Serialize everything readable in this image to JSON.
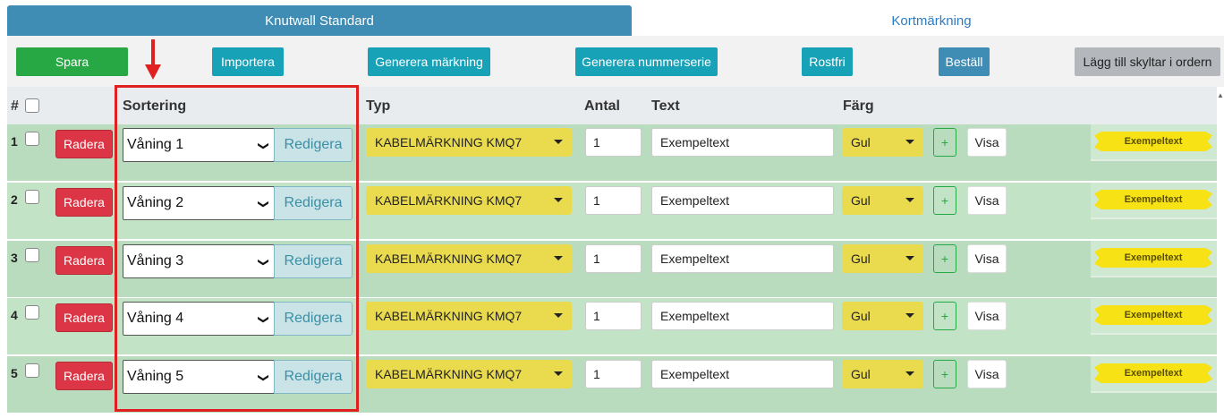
{
  "tabs": [
    {
      "label": "Knutwall Standard",
      "active": true
    },
    {
      "label": "Kortmärkning",
      "active": false
    }
  ],
  "toolbar": {
    "spara": "Spara",
    "importera": "Importera",
    "generera_markning": "Generera märkning",
    "generera_nummerserie": "Generera nummerserie",
    "rostfri": "Rostfri",
    "bestall": "Beställ",
    "lagg_till": "Lägg till skyltar i ordern"
  },
  "header": {
    "num": "#",
    "sortering": "Sortering",
    "typ": "Typ",
    "antal": "Antal",
    "text": "Text",
    "farg": "Färg"
  },
  "rows": [
    {
      "num": "1",
      "radera": "Radera",
      "sortering": "Våning 1",
      "redigera": "Redigera",
      "typ": "KABELMÄRKNING KMQ7",
      "antal": "1",
      "text": "Exempeltext",
      "farg": "Gul",
      "plus": "+",
      "visa": "Visa",
      "preview": "Exempeltext"
    },
    {
      "num": "2",
      "radera": "Radera",
      "sortering": "Våning 2",
      "redigera": "Redigera",
      "typ": "KABELMÄRKNING KMQ7",
      "antal": "1",
      "text": "Exempeltext",
      "farg": "Gul",
      "plus": "+",
      "visa": "Visa",
      "preview": "Exempeltext"
    },
    {
      "num": "3",
      "radera": "Radera",
      "sortering": "Våning 3",
      "redigera": "Redigera",
      "typ": "KABELMÄRKNING KMQ7",
      "antal": "1",
      "text": "Exempeltext",
      "farg": "Gul",
      "plus": "+",
      "visa": "Visa",
      "preview": "Exempeltext"
    },
    {
      "num": "4",
      "radera": "Radera",
      "sortering": "Våning 4",
      "redigera": "Redigera",
      "typ": "KABELMÄRKNING KMQ7",
      "antal": "1",
      "text": "Exempeltext",
      "farg": "Gul",
      "plus": "+",
      "visa": "Visa",
      "preview": "Exempeltext"
    },
    {
      "num": "5",
      "radera": "Radera",
      "sortering": "Våning 5",
      "redigera": "Redigera",
      "typ": "KABELMÄRKNING KMQ7",
      "antal": "1",
      "text": "Exempeltext",
      "farg": "Gul",
      "plus": "+",
      "visa": "Visa",
      "preview": "Exempeltext"
    }
  ],
  "icons": {
    "arrow": "down-arrow-icon",
    "select_chevron": "chevron-down-icon",
    "dropdown_caret": "caret-down-icon"
  },
  "colors": {
    "tab_active": "#3f8cb5",
    "save": "#28a745",
    "action": "#17a2b8",
    "order": "#3f8cb5",
    "delete": "#dc3545",
    "yellow": "#eadb4e",
    "annotation": "#e02020"
  }
}
